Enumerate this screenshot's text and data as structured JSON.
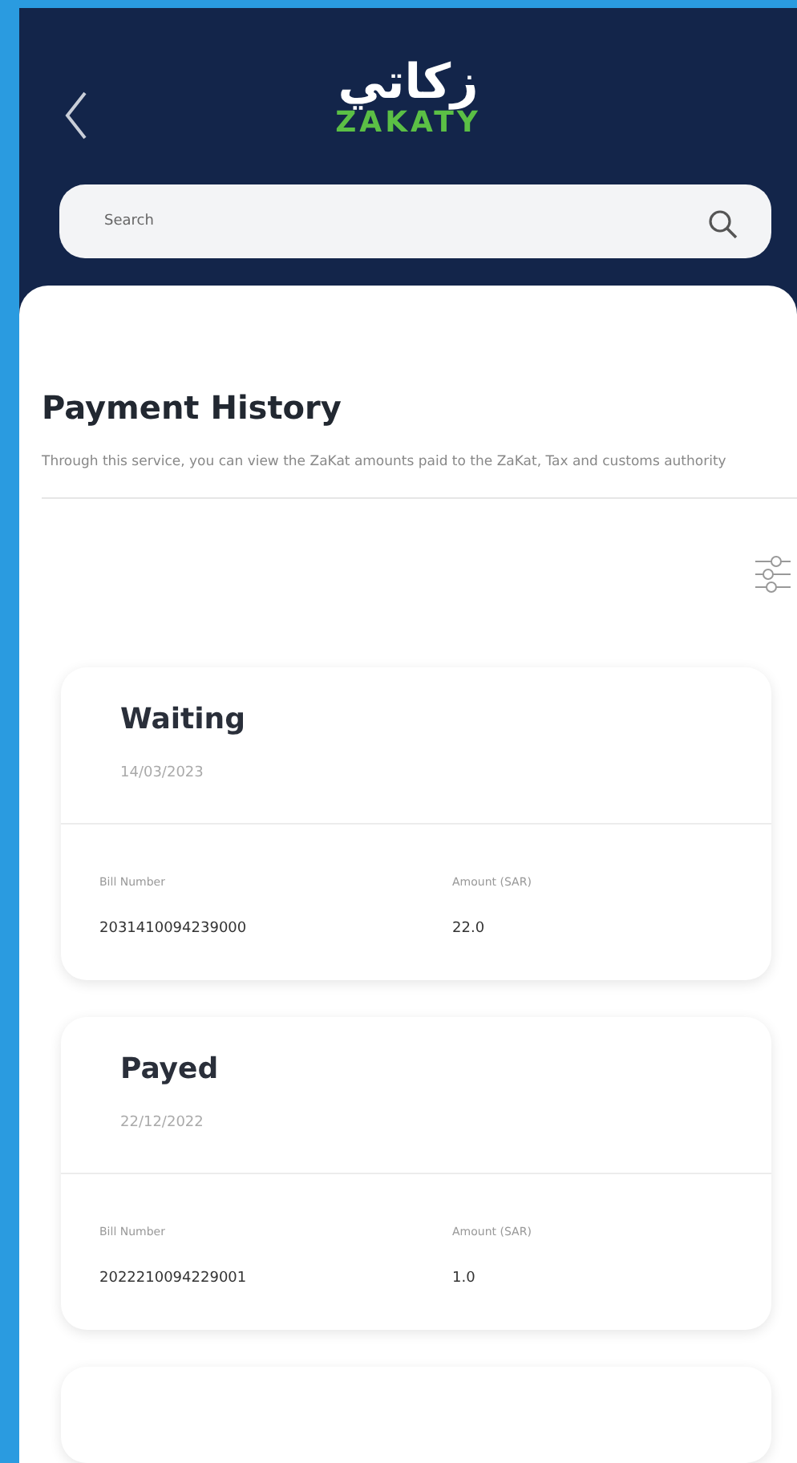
{
  "header": {
    "logo": {
      "arabic": "زكاتي",
      "latin": "ZAKATY"
    }
  },
  "search": {
    "placeholder": "Search"
  },
  "page": {
    "title": "Payment History",
    "description": "Through this service, you can view the ZaKat amounts paid to the ZaKat, Tax and customs authority"
  },
  "payments": [
    {
      "status": "Waiting",
      "date": "14/03/2023",
      "bill_label": "Bill Number",
      "bill_number": "2031410094239000",
      "amount_label": "Amount (SAR)",
      "amount": "22.0"
    },
    {
      "status": "Payed",
      "date": "22/12/2022",
      "bill_label": "Bill Number",
      "bill_number": "2022210094229001",
      "amount_label": "Amount (SAR)",
      "amount": "1.0"
    },
    {
      "kind": "partial"
    }
  ]
}
